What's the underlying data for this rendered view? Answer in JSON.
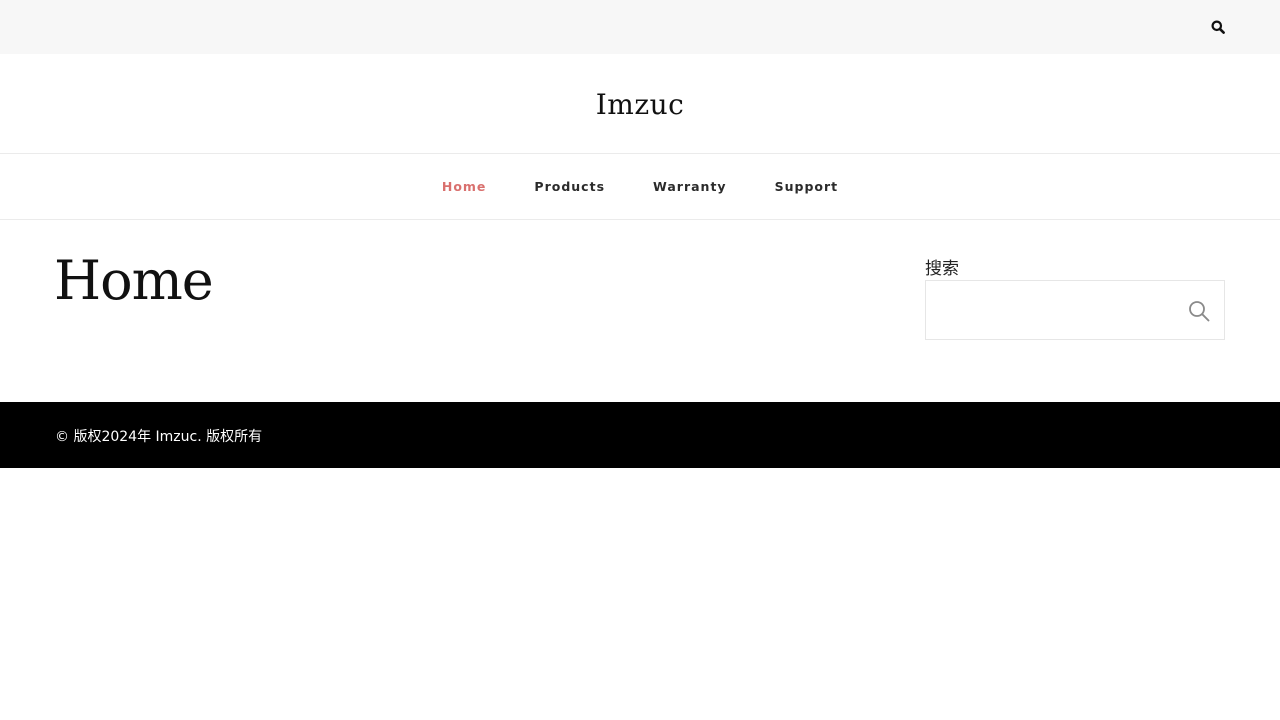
{
  "topbar": {
    "search_icon": "search-icon"
  },
  "header": {
    "site_title": "Imzuc"
  },
  "nav": {
    "items": [
      {
        "label": "Home",
        "active": true
      },
      {
        "label": "Products",
        "active": false
      },
      {
        "label": "Warranty",
        "active": false
      },
      {
        "label": "Support",
        "active": false
      }
    ],
    "active_color": "#d9706e",
    "text_color": "#2b2b2b"
  },
  "main": {
    "page_title": "Home"
  },
  "sidebar": {
    "search_widget": {
      "label": "搜索",
      "value": "",
      "placeholder": "",
      "submit_icon": "search-icon"
    }
  },
  "footer": {
    "copyright": "© 版权2024年 Imzuc. 版权所有"
  }
}
